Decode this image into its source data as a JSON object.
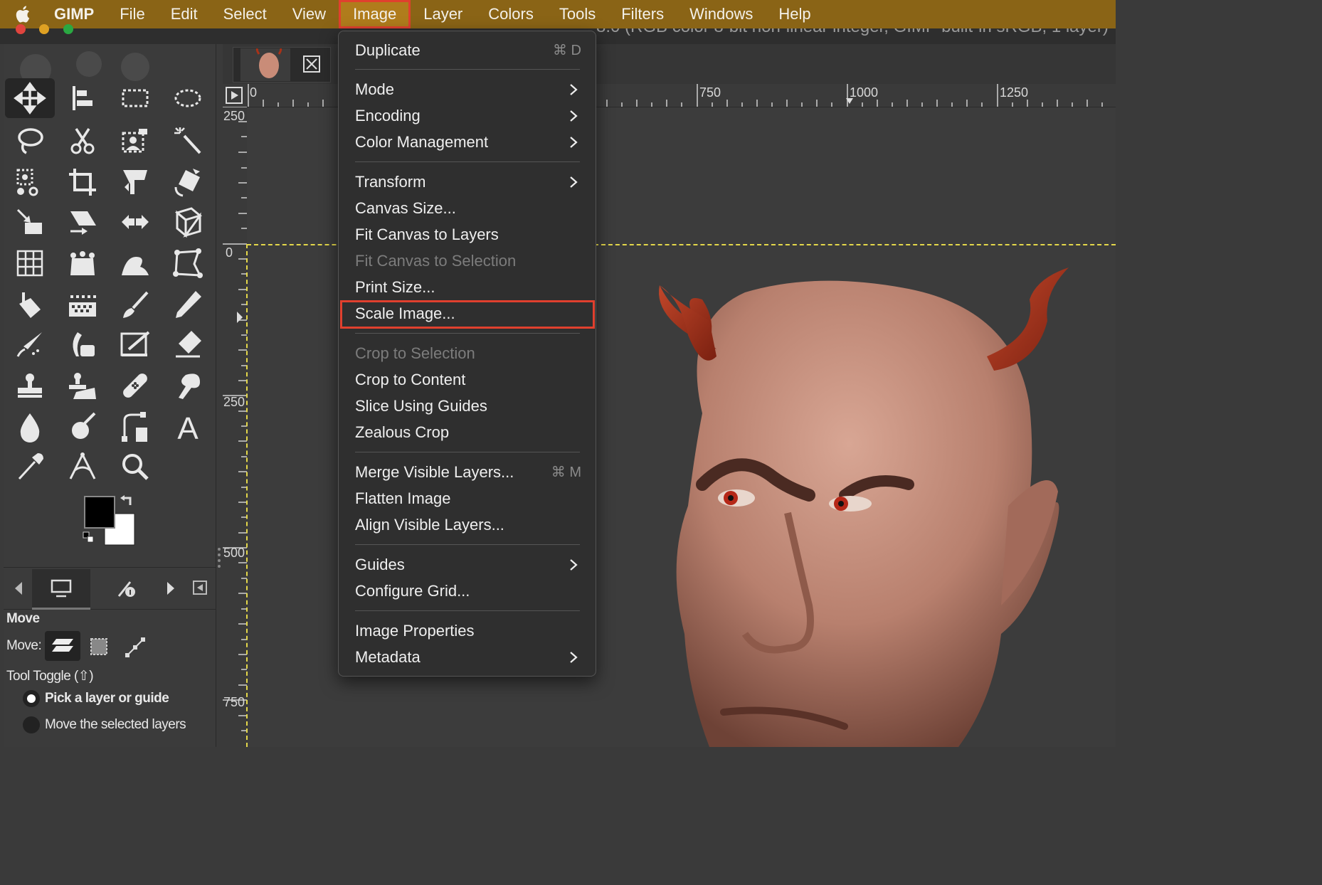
{
  "menubar": {
    "items": [
      "GIMP",
      "File",
      "Edit",
      "Select",
      "View",
      "Image",
      "Layer",
      "Colors",
      "Tools",
      "Filters",
      "Windows",
      "Help"
    ],
    "open_item": "Image"
  },
  "window": {
    "title_fragment": "8.0 (RGB color 8-bit non-linear integer, GIMP built-in sRGB, 1 layer)"
  },
  "rulers": {
    "horizontal": [
      "0",
      "750",
      "1000",
      "1250"
    ],
    "vertical": [
      "250",
      "0",
      "250",
      "500",
      "750"
    ]
  },
  "image_menu": {
    "items": [
      {
        "label": "Duplicate",
        "shortcut": "⌘ D"
      },
      {
        "label": "Mode",
        "submenu": true
      },
      {
        "label": "Encoding",
        "submenu": true
      },
      {
        "label": "Color Management",
        "submenu": true
      },
      {
        "label": "Transform",
        "submenu": true
      },
      {
        "label": "Canvas Size..."
      },
      {
        "label": "Fit Canvas to Layers"
      },
      {
        "label": "Fit Canvas to Selection",
        "disabled": true
      },
      {
        "label": "Print Size..."
      },
      {
        "label": "Scale Image...",
        "highlighted": true
      },
      {
        "label": "Crop to Selection",
        "disabled": true
      },
      {
        "label": "Crop to Content"
      },
      {
        "label": "Slice Using Guides"
      },
      {
        "label": "Zealous Crop"
      },
      {
        "label": "Merge Visible Layers...",
        "shortcut": "⌘ M"
      },
      {
        "label": "Flatten Image"
      },
      {
        "label": "Align Visible Layers..."
      },
      {
        "label": "Guides",
        "submenu": true
      },
      {
        "label": "Configure Grid..."
      },
      {
        "label": "Image Properties"
      },
      {
        "label": "Metadata",
        "submenu": true
      }
    ]
  },
  "tool_options": {
    "tool_name": "Move",
    "move_label": "Move:",
    "toggle_label": "Tool Toggle  (⇧)",
    "option_pick": "Pick a layer or guide",
    "option_move": "Move the selected layers"
  },
  "colors": {
    "menubar_bg": "#8a6416",
    "highlight_border": "#e0402e",
    "guide": "#e4d84a",
    "skin": "#c98c78",
    "horn": "#a83218"
  }
}
